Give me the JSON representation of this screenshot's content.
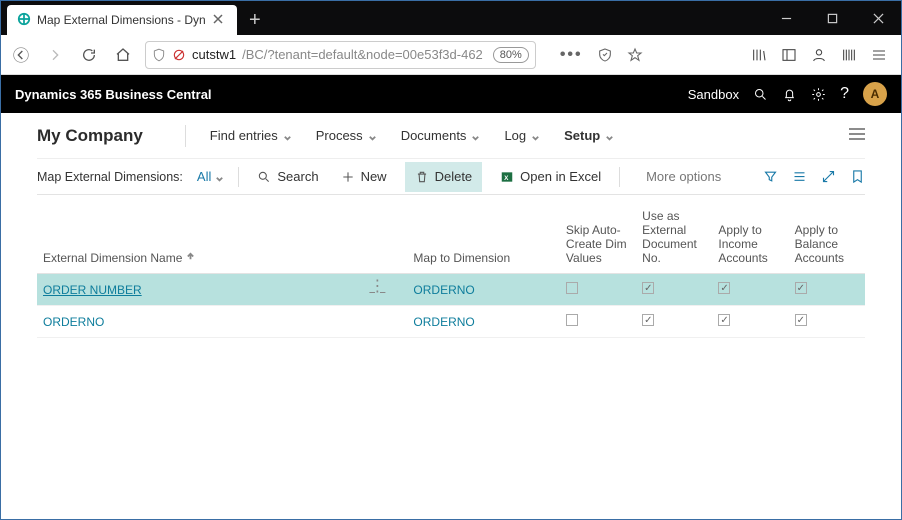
{
  "browser": {
    "tab_title": "Map External Dimensions - Dyn",
    "url_host": "cutstw1",
    "url_path": "/BC/?tenant=default&node=00e53f3d-462",
    "zoom": "80%"
  },
  "app": {
    "brand": "Dynamics 365 Business Central",
    "env": "Sandbox",
    "avatar": "A"
  },
  "page": {
    "company": "My Company",
    "menu": {
      "find": "Find entries",
      "process": "Process",
      "documents": "Documents",
      "log": "Log",
      "setup": "Setup"
    },
    "actionbar": {
      "label": "Map External Dimensions:",
      "filter": "All",
      "search": "Search",
      "new": "New",
      "delete": "Delete",
      "excel": "Open in Excel",
      "more": "More options"
    },
    "columns": {
      "name": "External Dimension Name",
      "map": "Map to Dimension",
      "skip": "Skip Auto-Create Dim Values",
      "extno": "Use as External Document No.",
      "income": "Apply to Income Accounts",
      "balance": "Apply to Balance Accounts"
    },
    "rows": [
      {
        "name": "ORDER NUMBER",
        "map": "ORDERNO",
        "skip": false,
        "extno": true,
        "income": true,
        "balance": true,
        "selected": true
      },
      {
        "name": "ORDERNO",
        "map": "ORDERNO",
        "skip": false,
        "extno": true,
        "income": true,
        "balance": true,
        "selected": false
      }
    ]
  }
}
